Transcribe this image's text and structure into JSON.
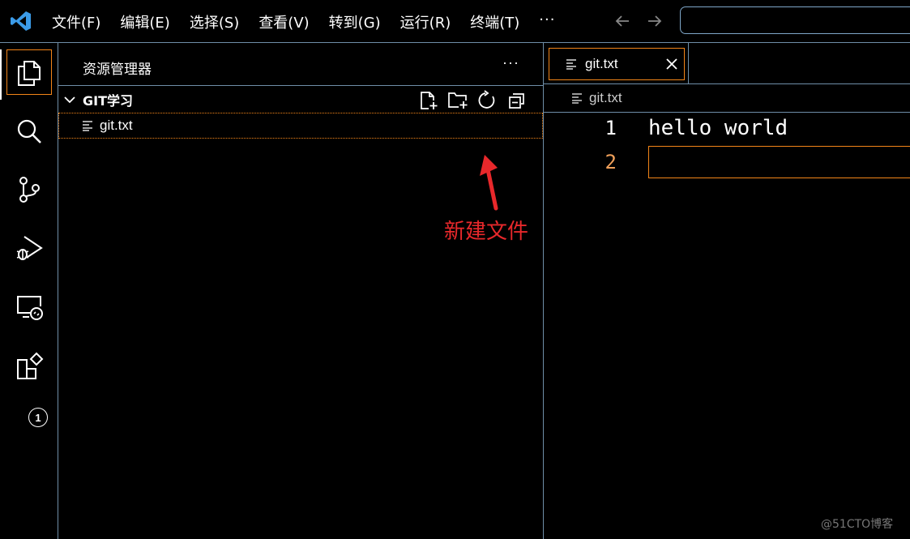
{
  "menu": [
    "文件(F)",
    "编辑(E)",
    "选择(S)",
    "查看(V)",
    "转到(G)",
    "运行(R)",
    "终端(T)"
  ],
  "menu_more": "···",
  "sidebar": {
    "title": "资源管理器",
    "more": "···",
    "section_title": "GIT学习",
    "files": [
      "git.txt"
    ]
  },
  "annotation": {
    "text": "新建文件",
    "color": "#e8282b"
  },
  "editor": {
    "tab_label": "git.txt",
    "breadcrumb": "git.txt",
    "lines": [
      {
        "number": "1",
        "text": "hello world"
      },
      {
        "number": "2",
        "text": ""
      }
    ]
  },
  "activity": {
    "extensions_badge": "1"
  },
  "watermark": "@51CTO博客",
  "colors": {
    "focus_border": "#f38518",
    "border": "#6f8ea8",
    "vscode_blue": "#3b9be8",
    "current_line_number": "#f0a05a"
  },
  "icons": [
    "vscode-logo-icon",
    "arrow-left-icon",
    "arrow-right-icon",
    "explorer-icon",
    "search-icon",
    "source-control-icon",
    "run-debug-icon",
    "remote-explorer-icon",
    "extensions-icon",
    "chevron-down-icon",
    "new-file-icon",
    "new-folder-icon",
    "refresh-icon",
    "collapse-all-icon",
    "file-text-icon",
    "close-icon"
  ]
}
